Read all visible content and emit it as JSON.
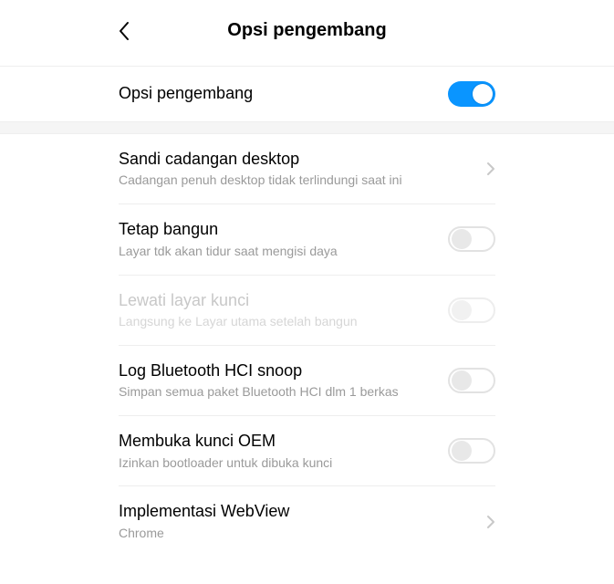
{
  "header": {
    "title": "Opsi pengembang"
  },
  "master": {
    "label": "Opsi pengembang",
    "on": true
  },
  "items": [
    {
      "title": "Sandi cadangan desktop",
      "subtitle": "Cadangan penuh desktop tidak terlindungi saat ini",
      "type": "link",
      "disabled": false
    },
    {
      "title": "Tetap bangun",
      "subtitle": "Layar tdk akan tidur saat mengisi daya",
      "type": "toggle",
      "on": false,
      "disabled": false
    },
    {
      "title": "Lewati layar kunci",
      "subtitle": "Langsung ke Layar utama setelah bangun",
      "type": "toggle",
      "on": false,
      "disabled": true
    },
    {
      "title": "Log Bluetooth HCI snoop",
      "subtitle": "Simpan semua paket Bluetooth HCI dlm 1 berkas",
      "type": "toggle",
      "on": false,
      "disabled": false
    },
    {
      "title": "Membuka kunci OEM",
      "subtitle": "Izinkan bootloader untuk dibuka kunci",
      "type": "toggle",
      "on": false,
      "disabled": false
    },
    {
      "title": "Implementasi WebView",
      "subtitle": "Chrome",
      "type": "link",
      "disabled": false
    }
  ]
}
